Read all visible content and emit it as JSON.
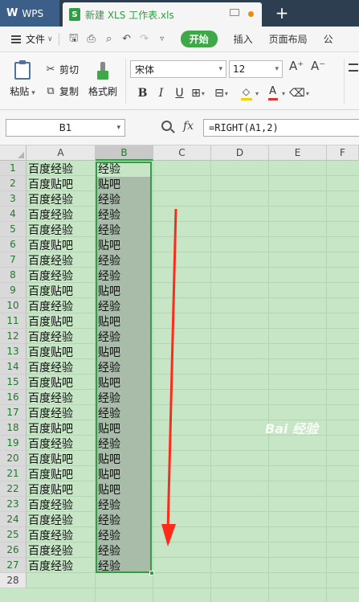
{
  "titlebar": {
    "app_label": "WPS",
    "doc_tab": "新建 XLS 工作表.xls",
    "xls_glyph": "S",
    "new_tab": "+"
  },
  "menubar": {
    "file": "文件",
    "start": "开始",
    "insert": "插入",
    "page_layout": "页面布局",
    "formulas_partial": "公"
  },
  "ribbon": {
    "paste": "粘贴",
    "cut": "剪切",
    "copy": "复制",
    "format_painter": "格式刷",
    "font_name": "宋体",
    "font_size": "12",
    "bold": "B",
    "italic": "I",
    "underline": "U",
    "font_color_glyph": "A"
  },
  "formulabar": {
    "cell_ref": "B1",
    "fx": "fx",
    "formula": "=RIGHT(A1,2)"
  },
  "sheet": {
    "columns": [
      "A",
      "B",
      "C",
      "D",
      "E",
      "F"
    ],
    "rows": [
      "1",
      "2",
      "3",
      "4",
      "5",
      "6",
      "7",
      "8",
      "9",
      "10",
      "11",
      "12",
      "13",
      "14",
      "15",
      "16",
      "17",
      "18",
      "19",
      "20",
      "21",
      "22",
      "23",
      "24",
      "25",
      "26",
      "27",
      "28"
    ],
    "col_a": [
      "百度经验",
      "百度贴吧",
      "百度经验",
      "百度经验",
      "百度经验",
      "百度贴吧",
      "百度经验",
      "百度经验",
      "百度贴吧",
      "百度经验",
      "百度贴吧",
      "百度经验",
      "百度贴吧",
      "百度经验",
      "百度贴吧",
      "百度经验",
      "百度经验",
      "百度贴吧",
      "百度经验",
      "百度贴吧",
      "百度贴吧",
      "百度贴吧",
      "百度经验",
      "百度经验",
      "百度经验",
      "百度经验",
      "百度经验"
    ],
    "col_b": [
      "经验",
      "贴吧",
      "经验",
      "经验",
      "经验",
      "贴吧",
      "经验",
      "经验",
      "贴吧",
      "经验",
      "贴吧",
      "经验",
      "贴吧",
      "经验",
      "贴吧",
      "经验",
      "经验",
      "贴吧",
      "经验",
      "贴吧",
      "贴吧",
      "贴吧",
      "经验",
      "经验",
      "经验",
      "经验",
      "经验"
    ]
  },
  "watermark": "Bai 经验",
  "colors": {
    "accent_green": "#2f9e44",
    "sheet_bg": "#c6e6c6",
    "arrow_red": "#ff2a1a"
  }
}
